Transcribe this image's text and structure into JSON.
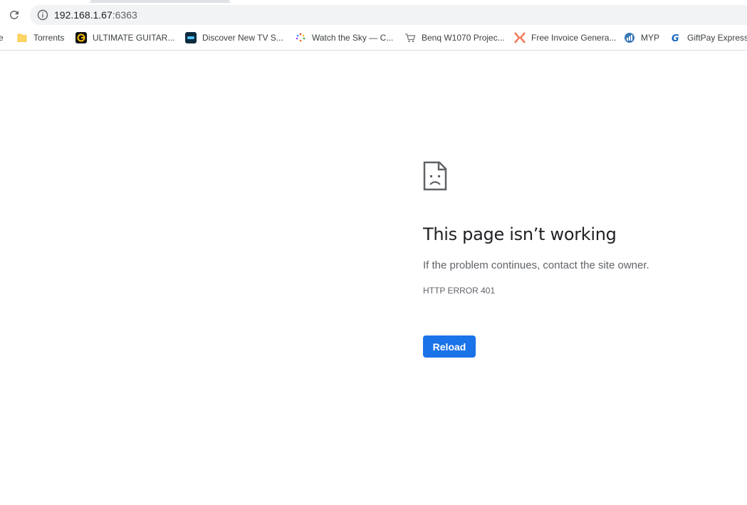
{
  "browser": {
    "omnibox": {
      "host": "192.168.1.67",
      "port": ":6363"
    },
    "bookmarks": [
      {
        "label": "e",
        "icon": "none"
      },
      {
        "label": "Torrents",
        "icon": "folder-icon"
      },
      {
        "label": "ULTIMATE GUITAR...",
        "icon": "ultimate-guitar-icon"
      },
      {
        "label": "Discover New TV S...",
        "icon": "tv-site-icon"
      },
      {
        "label": "Watch the Sky — C...",
        "icon": "sky-icon"
      },
      {
        "label": "Benq W1070 Projec...",
        "icon": "cart-icon"
      },
      {
        "label": "Free Invoice Genera...",
        "icon": "invoice-icon"
      },
      {
        "label": "MYP",
        "icon": "myp-icon"
      },
      {
        "label": "GiftPay Express",
        "icon": "giftpay-icon"
      }
    ]
  },
  "error_page": {
    "title": "This page isn’t working",
    "message": "If the problem continues, contact the site owner.",
    "code": "HTTP ERROR 401",
    "reload_label": "Reload"
  },
  "colors": {
    "accent": "#1a73e8",
    "title_text": "#202124",
    "body_text": "#5f6368"
  }
}
